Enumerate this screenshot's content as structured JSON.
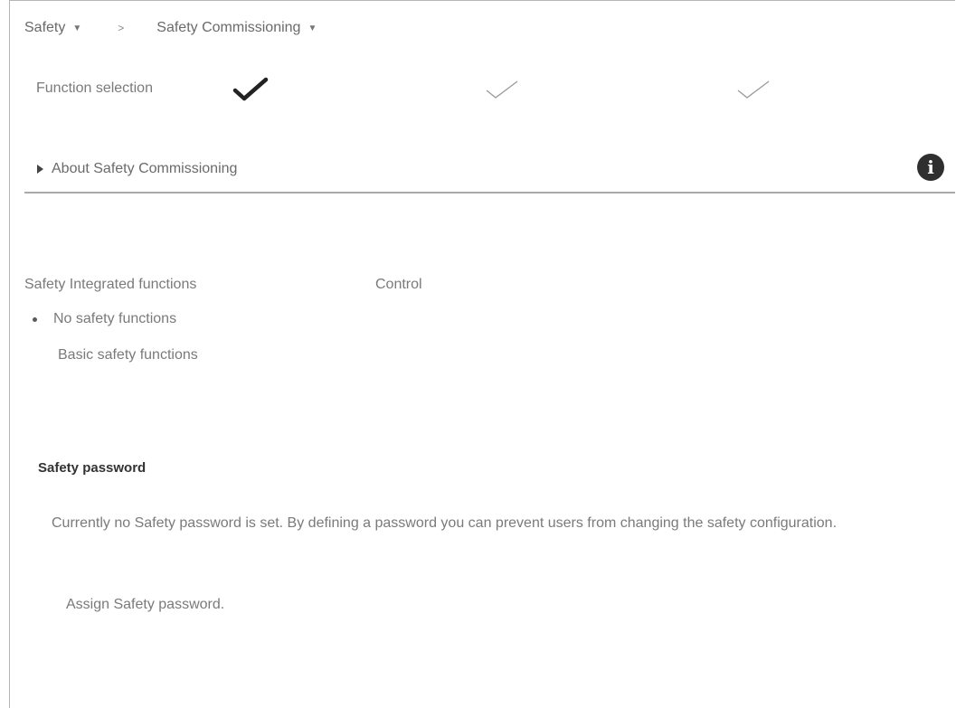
{
  "breadcrumb": {
    "items": [
      {
        "label": "Safety"
      },
      {
        "label": "Safety Commissioning"
      }
    ],
    "separator": ">"
  },
  "wizard": {
    "current_step_label": "Function selection",
    "steps": [
      {
        "status": "done"
      },
      {
        "status": "pending"
      },
      {
        "status": "pending"
      }
    ]
  },
  "about": {
    "label": "About Safety Commissioning",
    "info_icon": "info-icon"
  },
  "functions": {
    "header": "Safety Integrated functions",
    "control_header": "Control",
    "options": [
      {
        "label": "No safety functions",
        "selected": true
      },
      {
        "label": "Basic safety functions",
        "selected": false
      }
    ]
  },
  "password": {
    "title": "Safety password",
    "description": "Currently no Safety password is set. By defining a password you can prevent users from changing the safety configuration.",
    "assign_label": "Assign Safety password."
  }
}
